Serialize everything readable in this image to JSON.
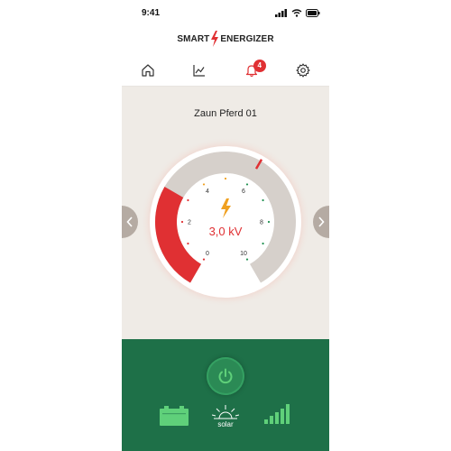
{
  "status_bar": {
    "time": "9:41",
    "icons": [
      "signal-icon",
      "wifi-icon",
      "battery-icon"
    ]
  },
  "brand": {
    "left": "SMART",
    "right": "ENERGIZER",
    "logo_icon": "bolt-icon",
    "accent_color": "#e03033"
  },
  "nav": {
    "items": [
      {
        "name": "home",
        "icon": "home-icon"
      },
      {
        "name": "chart",
        "icon": "chart-icon"
      },
      {
        "name": "alerts",
        "icon": "bell-icon",
        "badge": "4"
      },
      {
        "name": "settings",
        "icon": "gear-icon"
      }
    ]
  },
  "device": {
    "name": "Zaun Pferd 01",
    "voltage_label": "3,0 kV",
    "voltage_value": 3.0,
    "gauge": {
      "min": 0,
      "max": 10,
      "ticks": [
        "0",
        "2",
        "4",
        "6",
        "8",
        "10"
      ],
      "fill_color": "#e03033",
      "track_color": "#d6d0cb"
    }
  },
  "bottom": {
    "power_icon": "power-icon",
    "battery_icon": "battery-full-icon",
    "solar_icon": "sun-icon",
    "solar_label": "solar",
    "signal_icon": "signal-strength-icon",
    "bar_color": "#1e7048",
    "accent_green": "#5fd07a"
  }
}
